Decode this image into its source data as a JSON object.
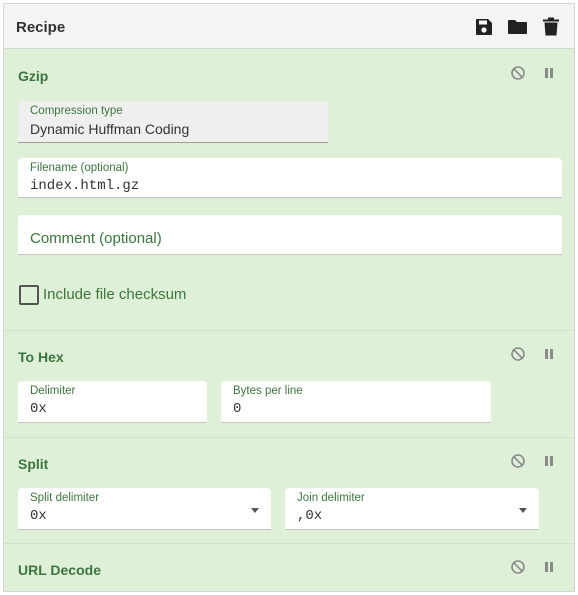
{
  "header": {
    "title": "Recipe",
    "icons": [
      "save-icon",
      "folder-icon",
      "trash-icon"
    ]
  },
  "operations": [
    {
      "title": "Gzip",
      "fields": {
        "compression": {
          "label": "Compression type",
          "value": "Dynamic Huffman Coding"
        },
        "filename": {
          "label": "Filename (optional)",
          "value": "index.html.gz"
        },
        "comment": {
          "placeholder": "Comment (optional)"
        },
        "checksum": {
          "label": "Include file checksum",
          "checked": false
        }
      }
    },
    {
      "title": "To Hex",
      "fields": {
        "delimiter": {
          "label": "Delimiter",
          "value": "0x"
        },
        "bytes": {
          "label": "Bytes per line",
          "value": "0"
        }
      }
    },
    {
      "title": "Split",
      "fields": {
        "split_delimiter": {
          "label": "Split delimiter",
          "value": "0x"
        },
        "join_delimiter": {
          "label": "Join delimiter",
          "value": ",0x"
        }
      }
    },
    {
      "title": "URL Decode"
    }
  ],
  "colors": {
    "op_bg": "#dff0d8",
    "op_text": "#3c763d",
    "header_bg": "#f4f4f4"
  }
}
